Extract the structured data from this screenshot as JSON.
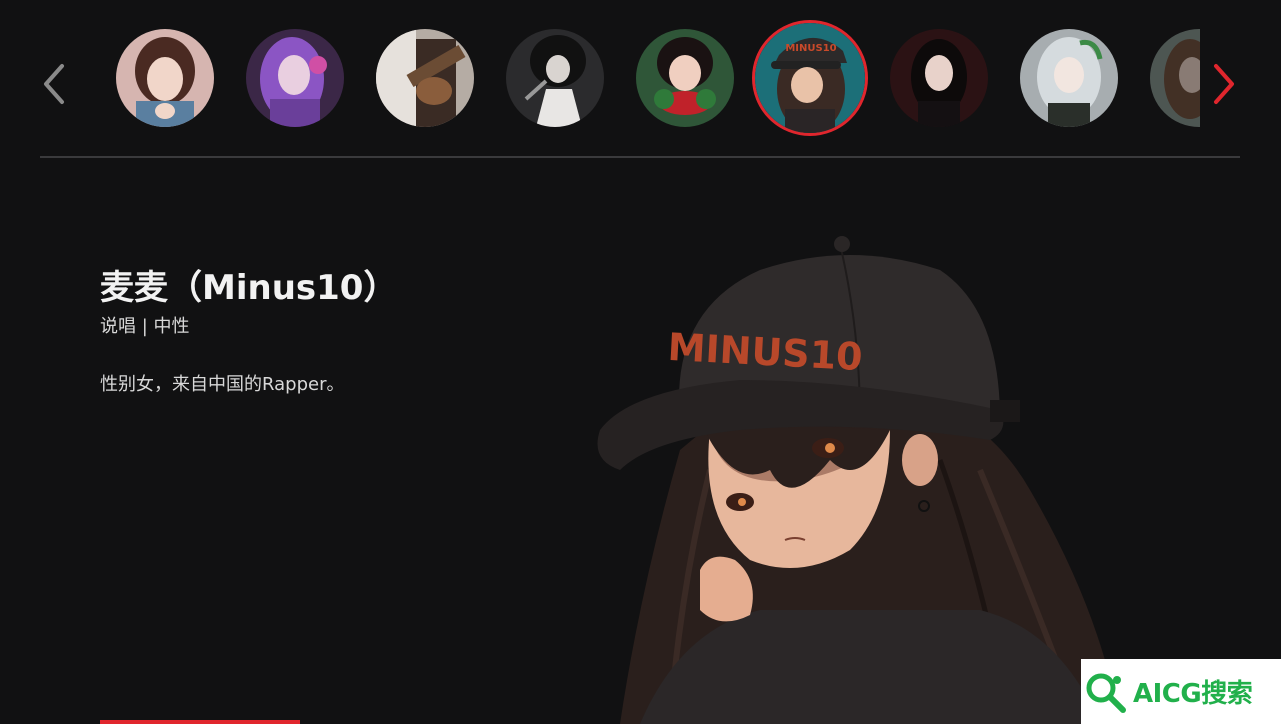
{
  "carousel": {
    "prev_icon": "chevron-left-icon",
    "next_icon": "chevron-right-icon",
    "accent_color": "#e0262d",
    "selected_index": 5,
    "avatars": [
      {
        "icon": "avatar-anime-girl-brown-hair",
        "bg": "#c9a9a6"
      },
      {
        "icon": "avatar-purple-hair-headphones",
        "bg": "#5a3a6e"
      },
      {
        "icon": "avatar-guitar-player",
        "bg": "#8a7d72"
      },
      {
        "icon": "avatar-singer-microphone",
        "bg": "#3a3a3a"
      },
      {
        "icon": "avatar-boy-red-scarf",
        "bg": "#2e5a3a"
      },
      {
        "icon": "avatar-minus10-cap-girl",
        "bg": "#1d6f79"
      },
      {
        "icon": "avatar-dark-hair-girl",
        "bg": "#2a1416"
      },
      {
        "icon": "avatar-silver-hair-girl",
        "bg": "#9aa0a3"
      },
      {
        "icon": "avatar-partial-girl",
        "bg": "#7d8e86"
      }
    ]
  },
  "profile": {
    "name": "麦麦（Minus10）",
    "tags": "说唱 | 中性",
    "description": "性别女，来自中国的Rapper。"
  },
  "hero": {
    "cap_text": "MINUS10"
  },
  "watermark": {
    "text": "AICG搜索"
  }
}
